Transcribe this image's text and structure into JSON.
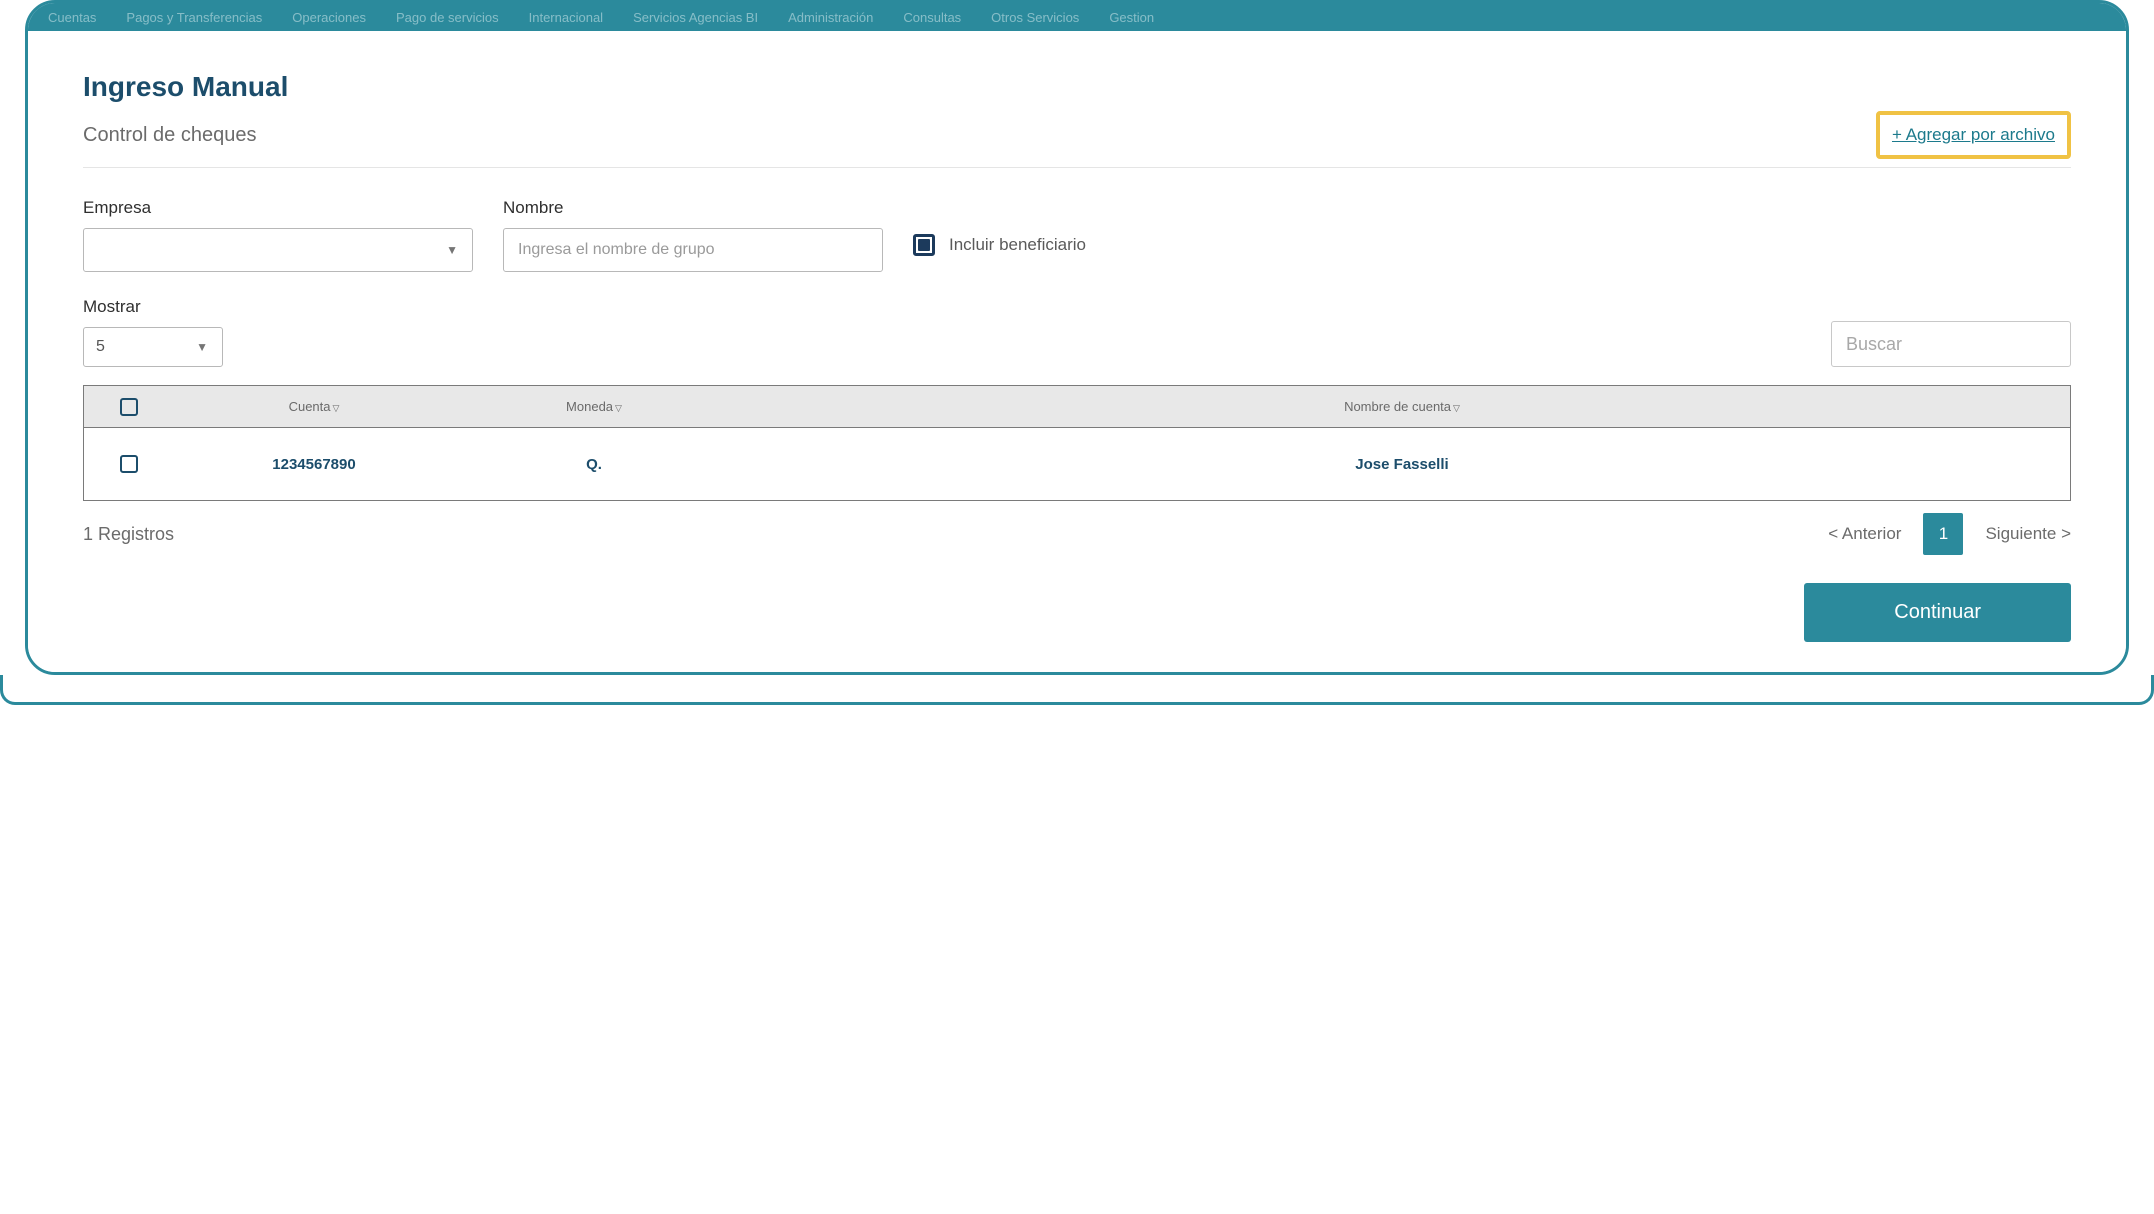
{
  "nav": {
    "items": [
      "Cuentas",
      "Pagos y Transferencias",
      "Operaciones",
      "Pago de servicios",
      "Internacional",
      "Servicios Agencias BI",
      "Administración",
      "Consultas",
      "Otros Servicios",
      "Gestion"
    ]
  },
  "page": {
    "title": "Ingreso Manual",
    "subtitle": "Control de cheques",
    "add_file_link": "+ Agregar por archivo"
  },
  "form": {
    "empresa_label": "Empresa",
    "nombre_label": "Nombre",
    "nombre_placeholder": "Ingresa el nombre de grupo",
    "incluir_label": "Incluir beneficiario",
    "mostrar_label": "Mostrar",
    "mostrar_value": "5",
    "search_placeholder": "Buscar"
  },
  "table": {
    "headers": {
      "cuenta": "Cuenta",
      "moneda": "Moneda",
      "nombre": "Nombre de cuenta"
    },
    "rows": [
      {
        "cuenta": "1234567890",
        "moneda": "Q.",
        "nombre": "Jose Fasselli"
      }
    ]
  },
  "footer": {
    "records": "1 Registros",
    "prev": "< Anterior",
    "current_page": "1",
    "next": "Siguiente >"
  },
  "actions": {
    "continue": "Continuar"
  }
}
